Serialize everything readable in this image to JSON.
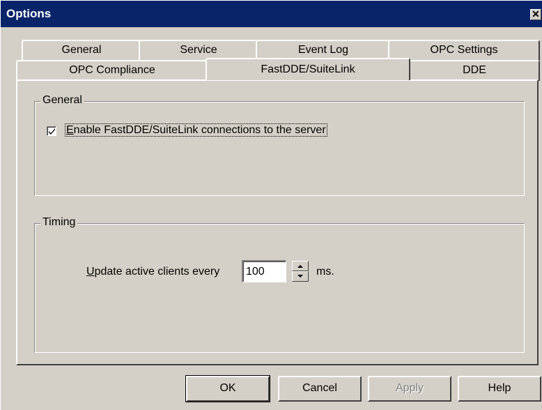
{
  "window": {
    "title": "Options",
    "close_glyph": "✕"
  },
  "tabs": {
    "row_back": [
      {
        "label": "General"
      },
      {
        "label": "Service"
      },
      {
        "label": "Event Log"
      },
      {
        "label": "OPC Settings"
      }
    ],
    "row_front": [
      {
        "label": "OPC Compliance"
      },
      {
        "label": "FastDDE/SuiteLink",
        "selected": true
      },
      {
        "label": "DDE"
      }
    ]
  },
  "general_group": {
    "legend": "General",
    "enable_checkbox": {
      "checked": true,
      "label_mnemonic": "E",
      "label_rest": "nable FastDDE/SuiteLink connections to the server"
    }
  },
  "timing_group": {
    "legend": "Timing",
    "update_label_mnemonic": "U",
    "update_label_rest": "pdate active clients every",
    "update_value": "100",
    "unit": "ms."
  },
  "buttons": {
    "ok": "OK",
    "cancel": "Cancel",
    "apply": "Apply",
    "help": "Help"
  },
  "colors": {
    "titlebar": "#0a246a",
    "face": "#d4d0c8"
  }
}
